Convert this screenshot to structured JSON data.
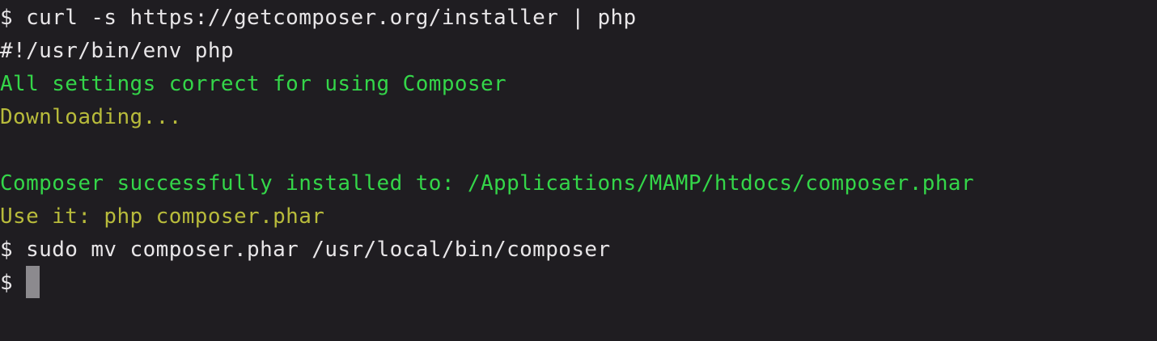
{
  "terminal": {
    "lines": [
      {
        "text": "$ curl -s https://getcomposer.org/installer | php",
        "color": "#e8e6e8"
      },
      {
        "text": "#!/usr/bin/env php",
        "color": "#e8e6e8"
      },
      {
        "text": "All settings correct for using Composer",
        "color": "#34d649"
      },
      {
        "text": "Downloading...",
        "color": "#b8bb3b"
      },
      {
        "text": "",
        "color": "#e8e6e8"
      },
      {
        "text": "Composer successfully installed to: /Applications/MAMP/htdocs/composer.phar",
        "color": "#34d649"
      },
      {
        "text": "Use it: php composer.phar",
        "color": "#b8bb3b"
      },
      {
        "text": "$ sudo mv composer.phar /usr/local/bin/composer",
        "color": "#e8e6e8"
      }
    ],
    "prompt": "$ ",
    "background": "#1f1d21",
    "cursor_color": "#8c8a8e"
  }
}
